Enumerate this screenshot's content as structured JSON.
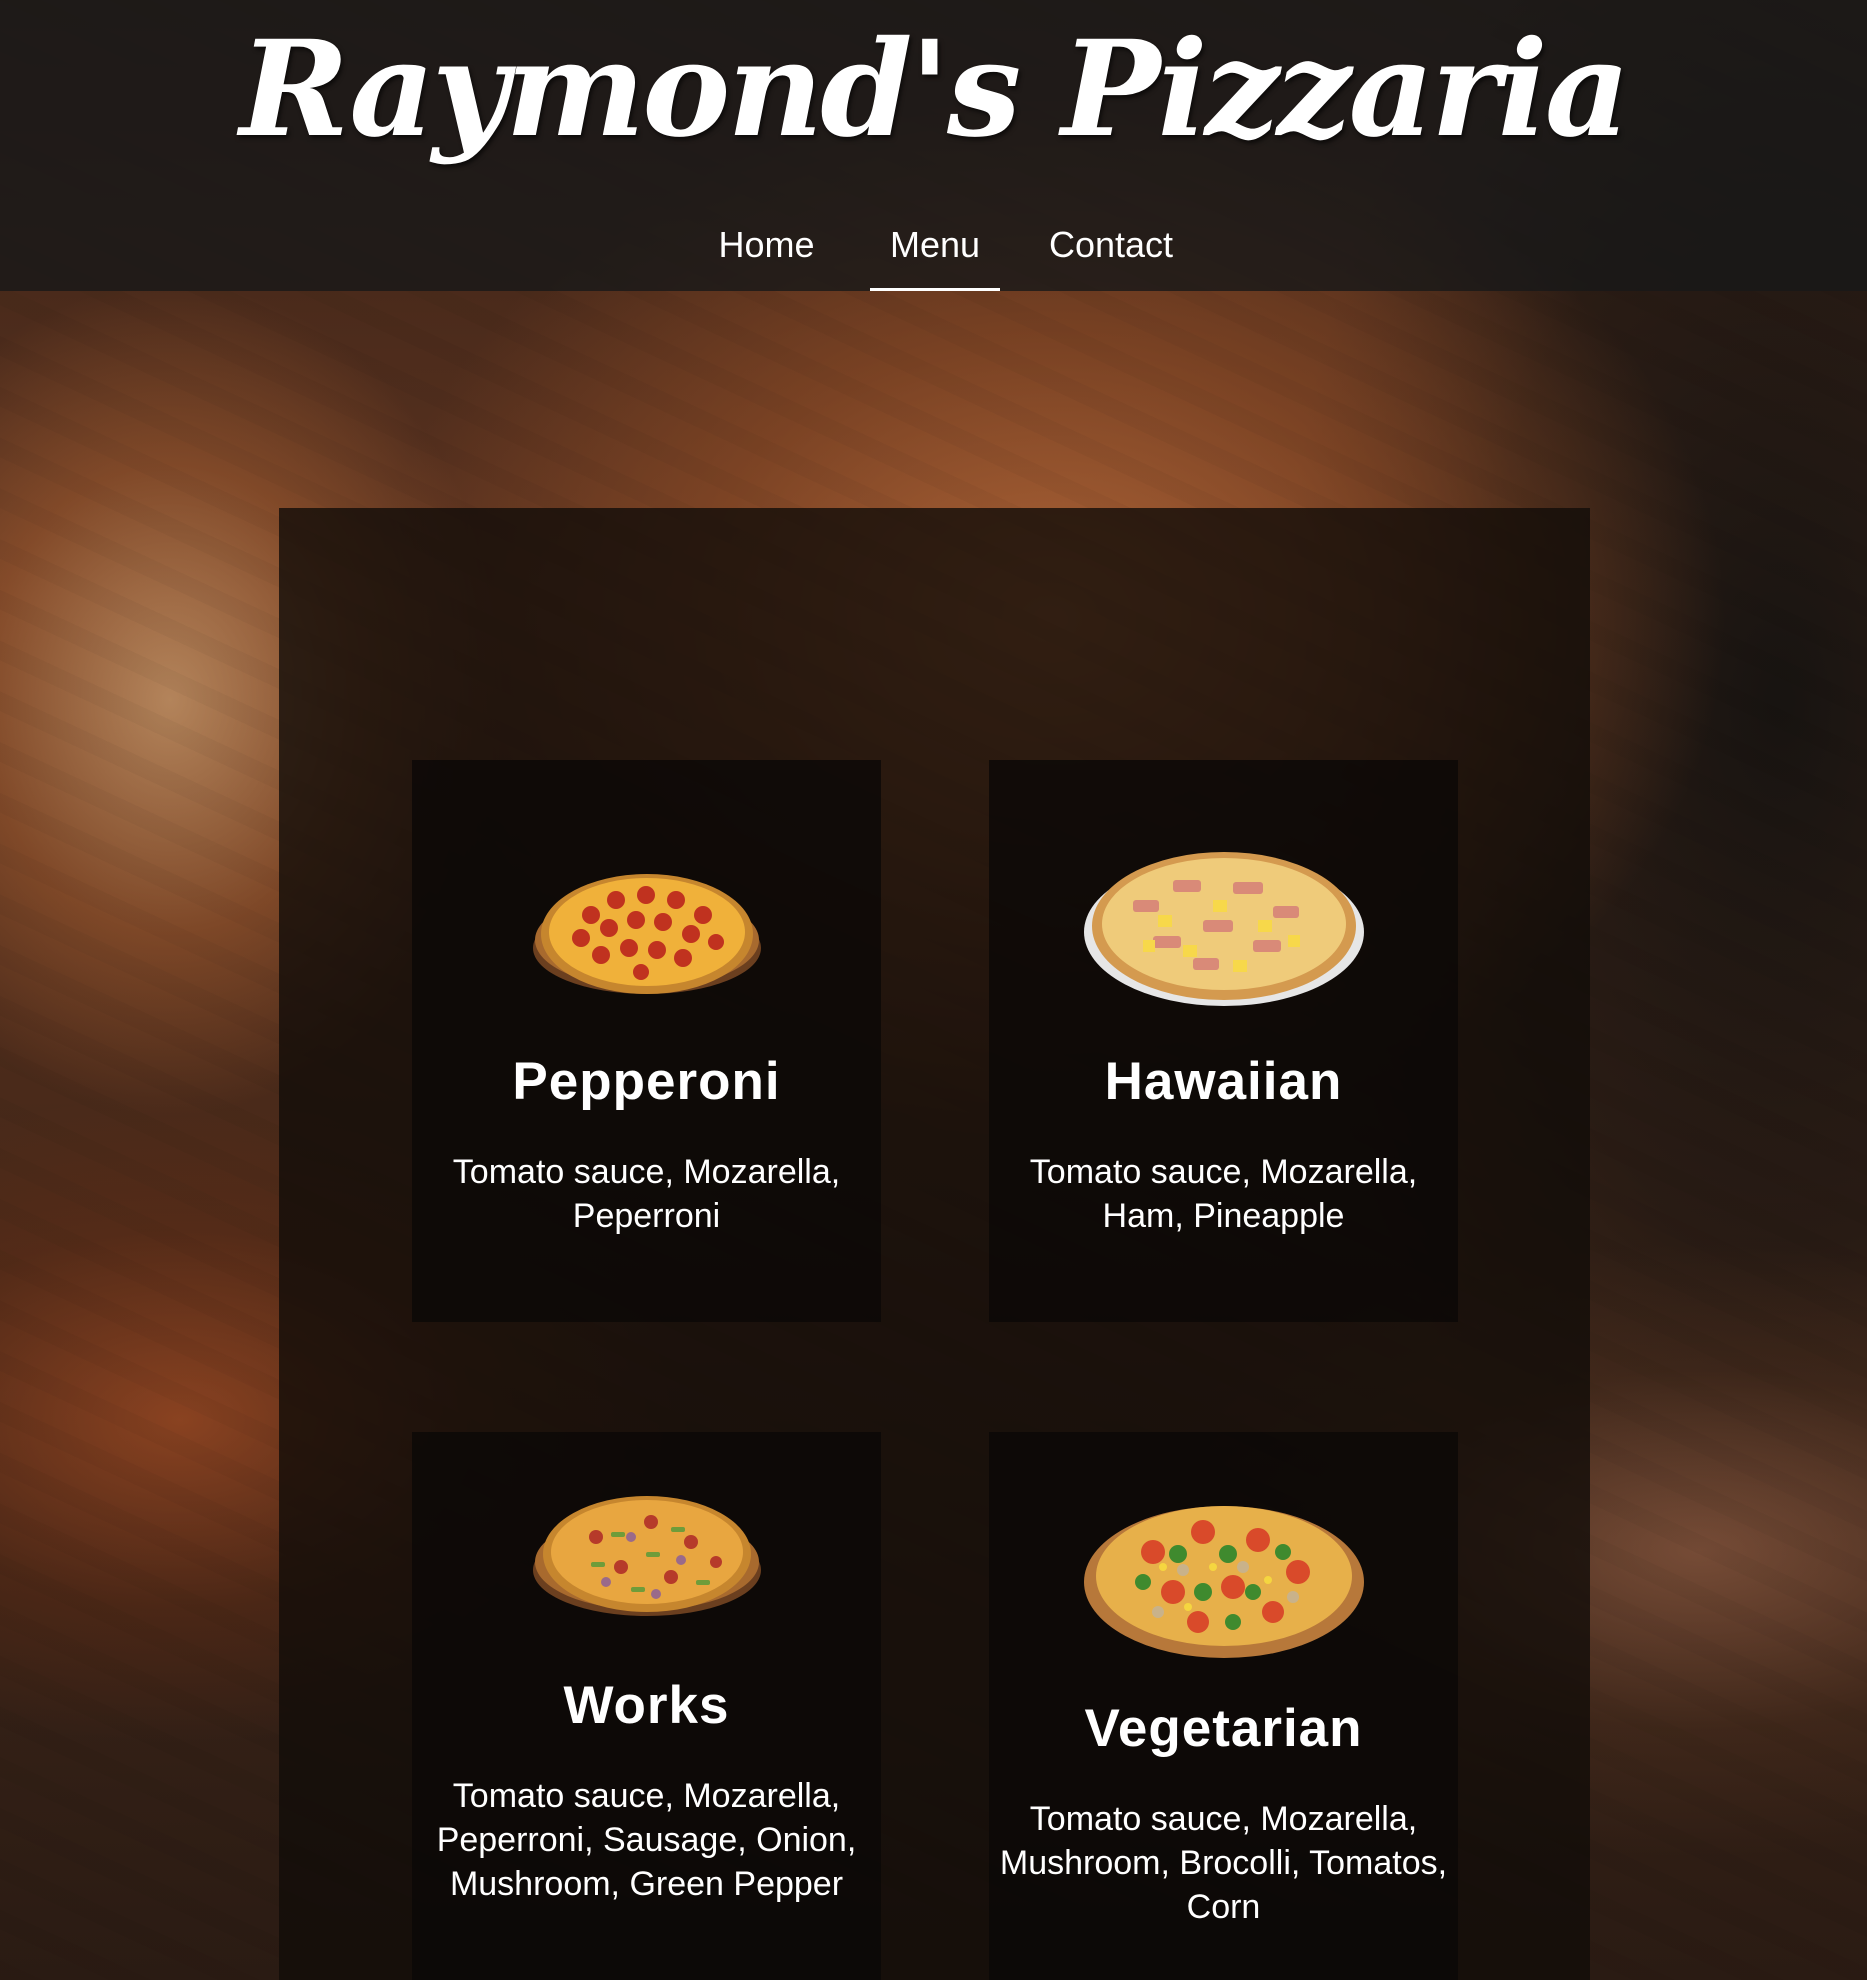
{
  "site": {
    "logo": "Raymond's Pizzaria"
  },
  "nav": {
    "items": [
      {
        "label": "Home",
        "active": false
      },
      {
        "label": "Menu",
        "active": true
      },
      {
        "label": "Contact",
        "active": false
      }
    ]
  },
  "menu": {
    "pizzas": [
      {
        "name": "Pepperoni",
        "ingredients": "Tomato sauce, Mozarella, Peperroni",
        "image": "pepperoni-pizza"
      },
      {
        "name": "Hawaiian",
        "ingredients": "Tomato sauce, Mozarella, Ham, Pineapple",
        "image": "hawaiian-pizza"
      },
      {
        "name": "Works",
        "ingredients": "Tomato sauce, Mozarella, Peperroni, Sausage, Onion, Mushroom, Green Pepper",
        "image": "works-pizza"
      },
      {
        "name": "Vegetarian",
        "ingredients": "Tomato sauce, Mozarella, Mushroom, Brocolli, Tomatos, Corn",
        "image": "vegetarian-pizza"
      }
    ]
  },
  "colors": {
    "header_bg": "#181818",
    "text": "#ffffff",
    "panel_bg": "#120c09",
    "oven_glow": "#be6e3c"
  }
}
